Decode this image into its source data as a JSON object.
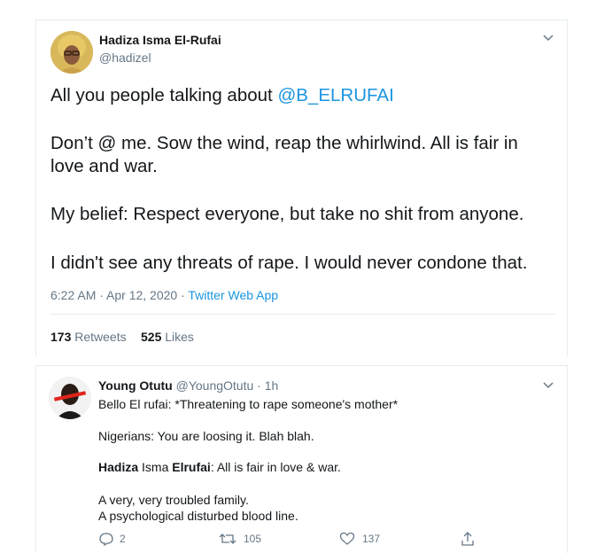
{
  "tweet1": {
    "author_name": "Hadiza Isma El-Rufai",
    "handle": "@hadizel",
    "line1_prefix": "All you people talking about ",
    "line1_mention": "@B_ELRUFAI",
    "para2_line1": "Don’t @ me. Sow the wind, reap the whirlwind. All is fair in",
    "para2_line2": "love and war.",
    "para3": "My belief: Respect everyone, but take no shit from anyone.",
    "para4": "I didn't see any threats of rape. I would never condone that.",
    "timestamp": "6:22 AM · Apr 12, 2020 · ",
    "source_app": "Twitter Web App",
    "retweets_count": "173",
    "retweets_label": "Retweets",
    "likes_count": "525",
    "likes_label": "Likes"
  },
  "tweet2": {
    "author_name": "Young Otutu",
    "handle": "@YoungOtutu",
    "time": "· 1h",
    "line1": "Bello El rufai: *Threatening to rape someone's mother*",
    "line2": "Nigerians: You are loosing it. Blah blah.",
    "line3_bold1": "Hadiza",
    "line3_mid": " Isma ",
    "line3_bold2": "Elrufai",
    "line3_rest": ": All is fair in love & war.",
    "line4": "A very, very troubled family.",
    "line5": "A psychological disturbed blood line.",
    "reply_count": "2",
    "retweet_count": "105",
    "like_count": "137"
  },
  "icons": [
    "chevron-down-icon",
    "reply-icon",
    "retweet-icon",
    "like-icon",
    "share-icon"
  ],
  "colors": {
    "link": "#1b95e0",
    "muted": "#657786",
    "text": "#14171a",
    "border": "#e6ecf0"
  }
}
